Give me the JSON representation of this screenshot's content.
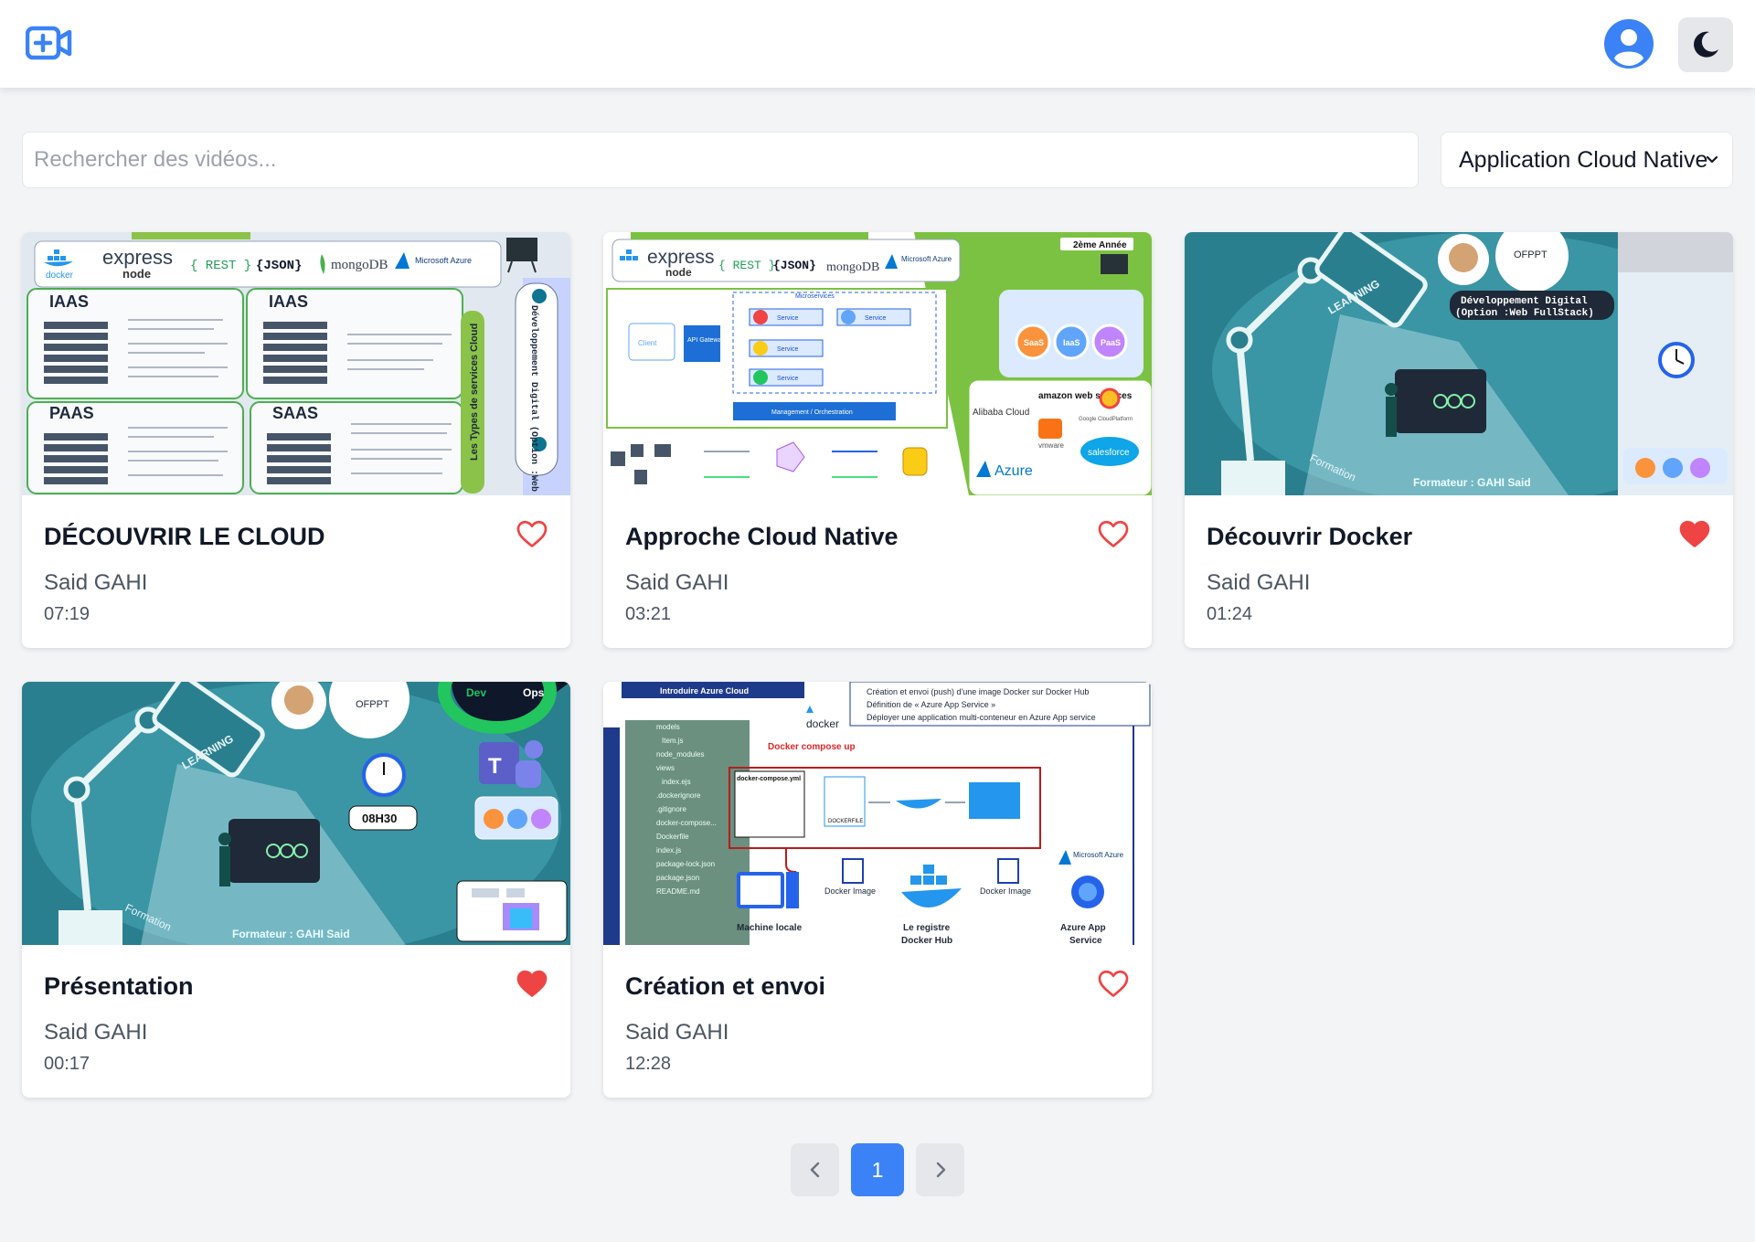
{
  "header": {
    "logo_icon": "video-plus-icon",
    "user_icon": "user-circle-icon",
    "theme_icon": "moon-icon",
    "accent_color": "#3b82f6"
  },
  "search": {
    "placeholder": "Rechercher des vidéos..."
  },
  "filter": {
    "selected": "Application Cloud Native",
    "icon": "chevron-down-icon"
  },
  "videos": [
    {
      "title": "DÉCOUVRIR LE CLOUD",
      "author": "Said GAHI",
      "duration": "07:19",
      "favorite": false
    },
    {
      "title": "Approche Cloud Native",
      "author": "Said GAHI",
      "duration": "03:21",
      "favorite": false
    },
    {
      "title": "Découvrir Docker",
      "author": "Said GAHI",
      "duration": "01:24",
      "favorite": true
    },
    {
      "title": "Présentation",
      "author": "Said GAHI",
      "duration": "00:17",
      "favorite": true
    },
    {
      "title": "Création et envoi",
      "author": "Said GAHI",
      "duration": "12:28",
      "favorite": false
    }
  ],
  "thumbnails": {
    "t1": {
      "express": "express",
      "node": "node",
      "rest": "{ REST }",
      "json": "{JSON}",
      "mongo": "mongoDB",
      "azure": "Microsoft Azure",
      "iaas": "IAAS",
      "paas": "PAAS",
      "saas": "SAAS",
      "side": "Les Types de services Cloud",
      "vertical": "Développement Digital (Option :Web FullStack)"
    },
    "t2": {
      "express": "express",
      "node": "node",
      "rest": "{ REST }",
      "json": "{JSON}",
      "mongo": "mongoDB",
      "azure": "Microsoft Azure",
      "year": "2ème Année",
      "client": "Client",
      "gateway": "API Gateway",
      "microservices": "Microservices",
      "service": "Service",
      "orchestration": "Management / Orchestration",
      "alibaba": "Alibaba Cloud",
      "amazon": "amazon web services",
      "google": "Google CloudPlatform",
      "vmware": "vmware",
      "salesforce": "salesforce",
      "azure_big": "Azure",
      "saas": "SaaS",
      "iaas": "IaaS",
      "paas": "PaaS"
    },
    "t3": {
      "ofppt": "OFPPT",
      "dev": "Développement Digital",
      "option": "(Option :Web FullStack)",
      "learning": "LEARNING",
      "formation": "Formation",
      "formateur": "Formateur : GAHI Said"
    },
    "t4": {
      "ofppt": "OFPPT",
      "devops_dev": "Dev",
      "devops_ops": "Ops",
      "time": "08H30",
      "learning": "LEARNING",
      "formation": "Formation",
      "formateur": "Formateur : GAHI Said"
    },
    "t5": {
      "banner": "Introduire Azure Cloud",
      "line1": "Création et envoi (push) d'une image Docker sur Docker Hub",
      "line2": "Définition de « Azure App Service »",
      "line3": "Déployer une application multi-conteneur en Azure App service",
      "files": [
        "models",
        "Item.js",
        "node_modules",
        "views",
        "index.ejs",
        ".dockerignore",
        ".gitignore",
        "docker-compose...",
        "Dockerfile",
        "index.js",
        "package-lock.json",
        "package.json",
        "README.md"
      ],
      "compose_up": "Docker compose up",
      "compose_file": "docker-compose.yml",
      "dockerfile": "DOCKERFILE",
      "docker": "docker",
      "docker_image": "Docker Image",
      "machine": "Machine locale",
      "registry1": "Le registre",
      "registry2": "Docker Hub",
      "azure_app1": "Azure App",
      "azure_app2": "Service",
      "ms_azure": "Microsoft Azure"
    }
  },
  "pagination": {
    "current": "1",
    "prev_icon": "chevron-left-icon",
    "next_icon": "chevron-right-icon"
  }
}
